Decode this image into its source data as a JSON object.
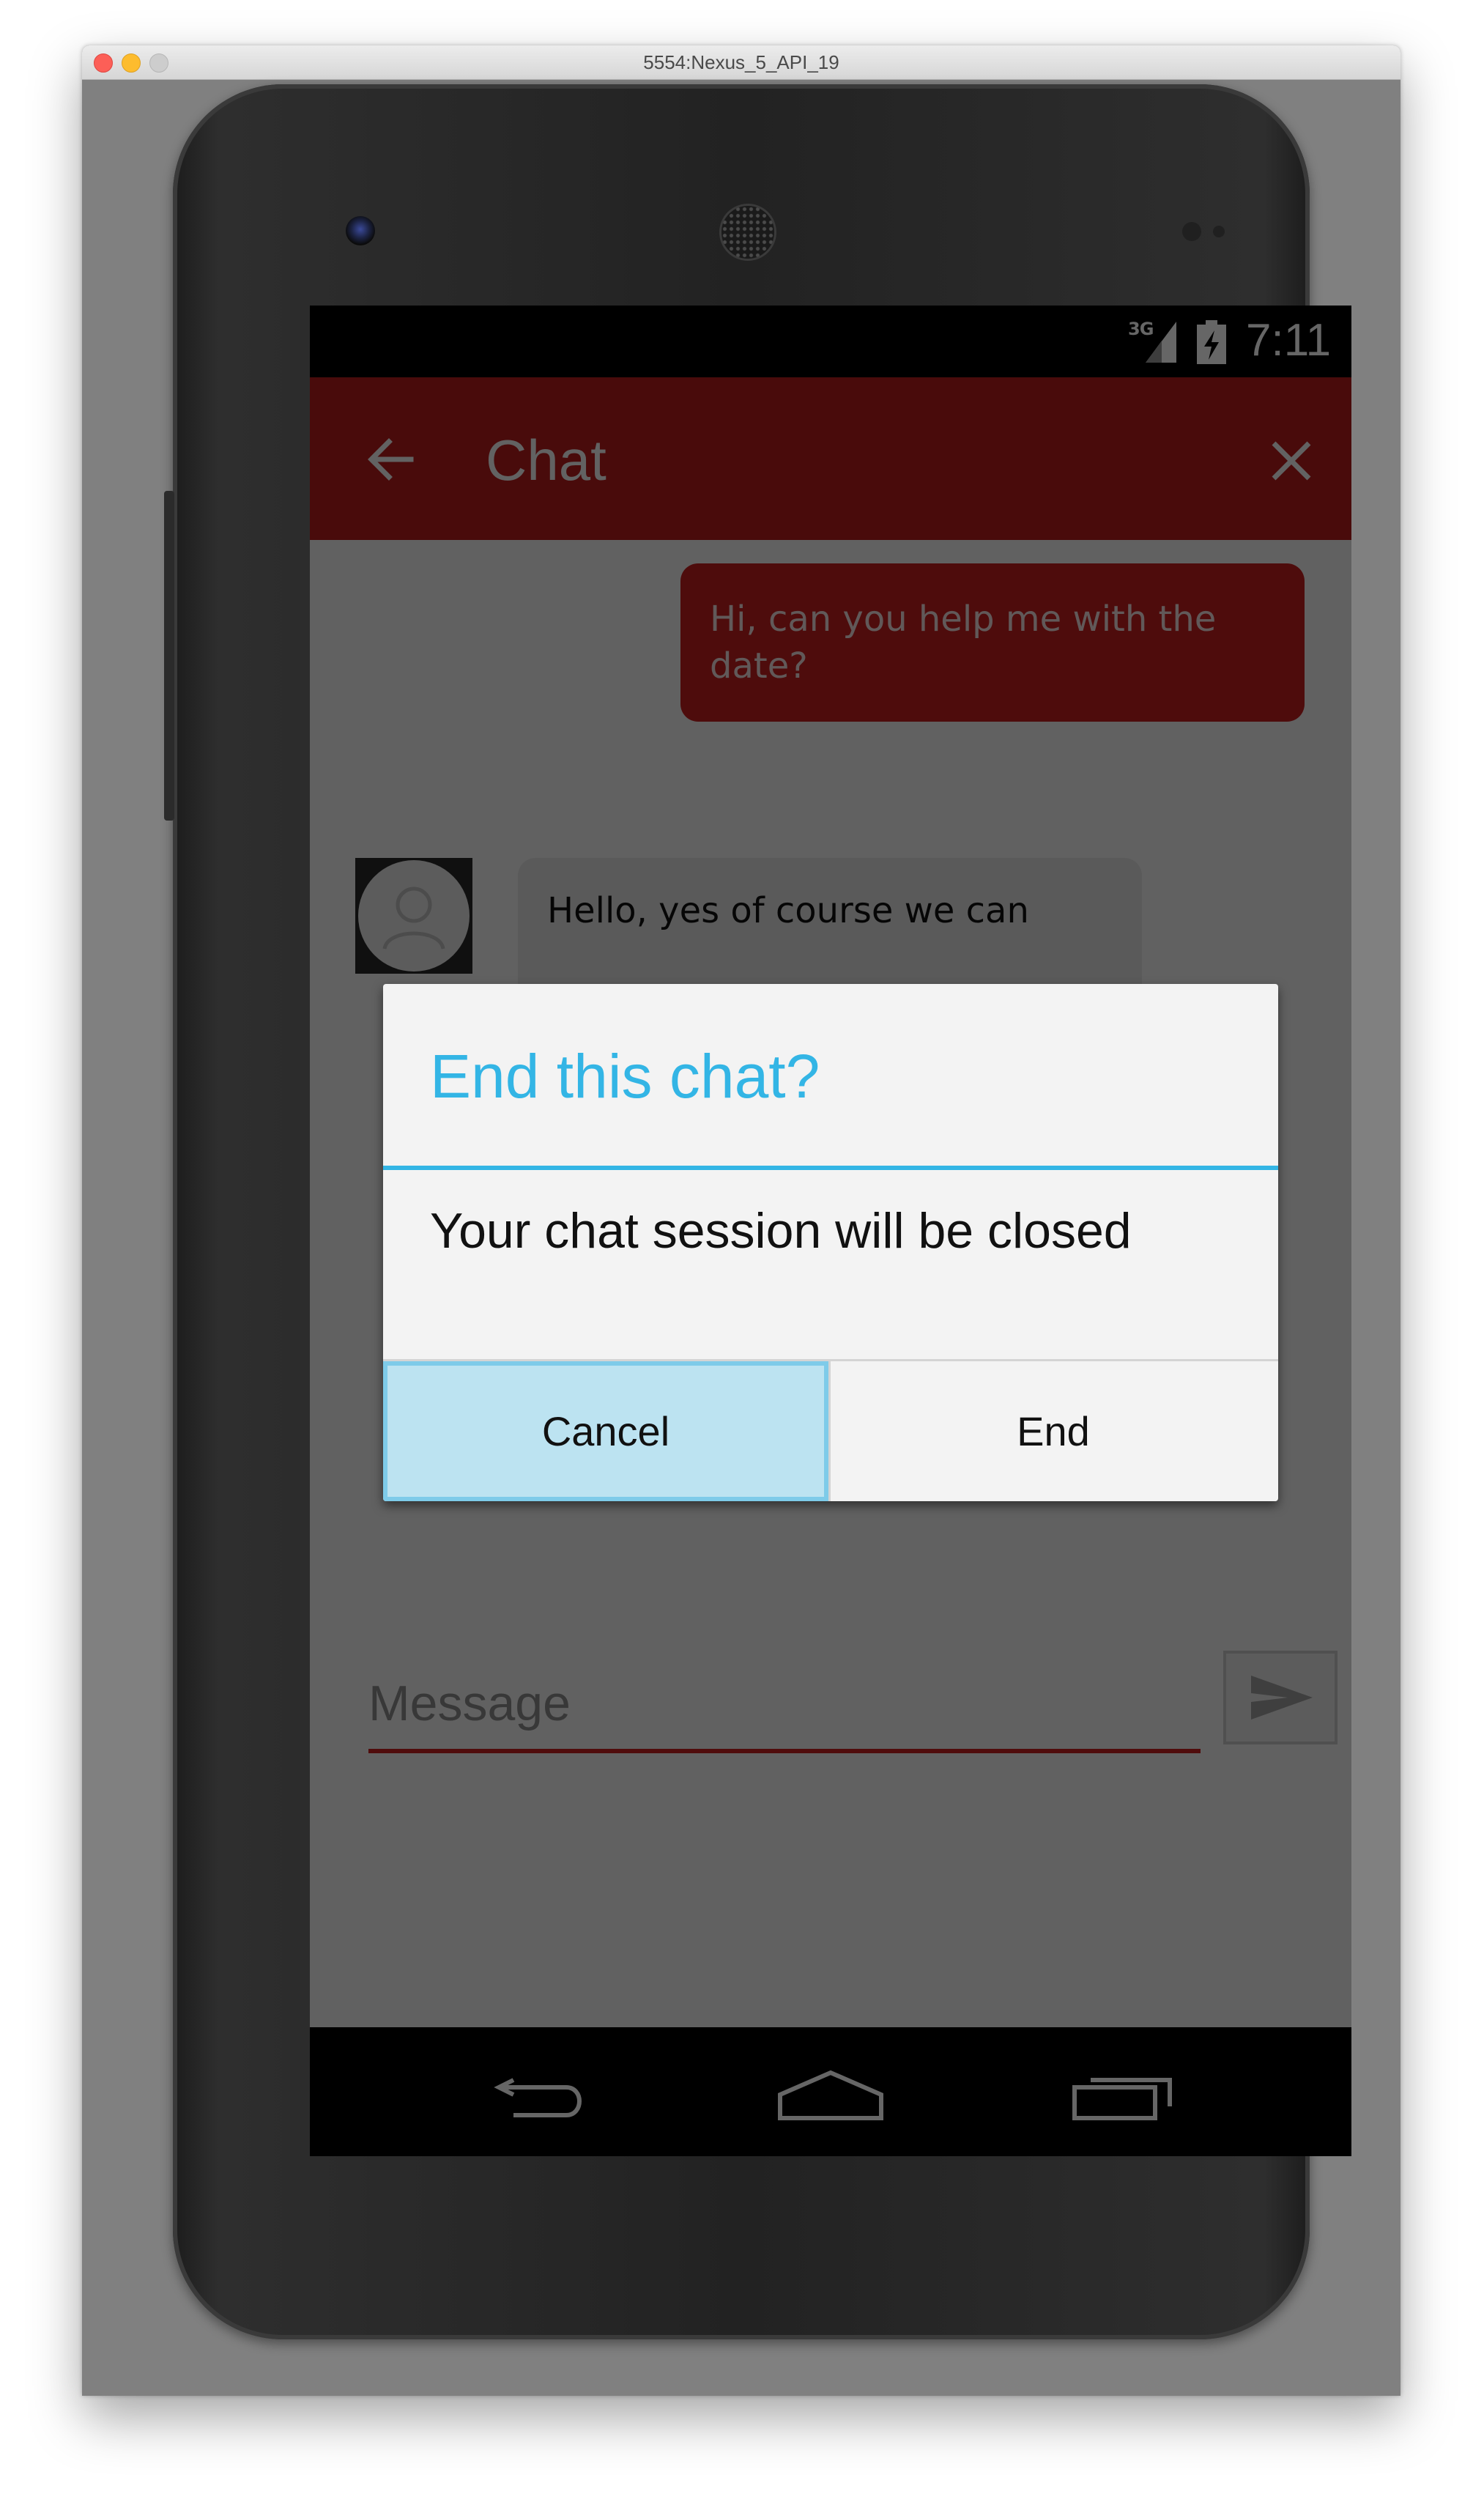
{
  "window": {
    "title": "5554:Nexus_5_API_19"
  },
  "status_bar": {
    "network": "3G",
    "time": "7:11"
  },
  "app_bar": {
    "title": "Chat",
    "back_icon": "arrow-back-icon",
    "close_icon": "close-icon",
    "color": "#b71c1c"
  },
  "messages": [
    {
      "from": "user",
      "text": "Hi, can you help me with the date?"
    },
    {
      "from": "agent",
      "text": "Hello, yes of course we can"
    }
  ],
  "composer": {
    "placeholder": "Message",
    "send_icon": "send-icon"
  },
  "nav_bar": {
    "icons": [
      "back-icon",
      "home-icon",
      "recents-icon"
    ]
  },
  "dialog": {
    "title": "End this chat?",
    "message": "Your chat session will be closed",
    "cancel_label": "Cancel",
    "end_label": "End",
    "accent": "#33b5e5"
  }
}
